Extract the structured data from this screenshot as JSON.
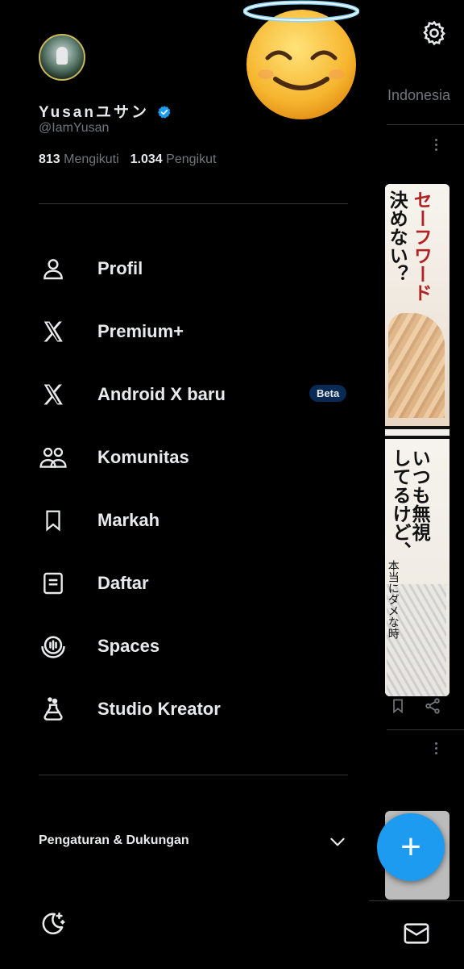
{
  "colors": {
    "background": "#000000",
    "text": "#e7e9ea",
    "muted": "#71767b",
    "accent": "#1d9bf0",
    "divider": "#2f3336",
    "beta_bg": "#082a55"
  },
  "profile": {
    "display_name": "Yusanユサン",
    "handle": "@IamYusan",
    "verified_icon": "verified-badge-icon",
    "following_count": "813",
    "following_label": "Mengikuti",
    "followers_count": "1.034",
    "followers_label": "Pengikut"
  },
  "menu": {
    "items": [
      {
        "label": "Profil",
        "icon": "person-icon"
      },
      {
        "label": "Premium+",
        "icon": "x-logo-icon"
      },
      {
        "label": "Android X baru",
        "icon": "x-logo-icon",
        "badge": "Beta"
      },
      {
        "label": "Komunitas",
        "icon": "people-icon"
      },
      {
        "label": "Markah",
        "icon": "bookmark-icon"
      },
      {
        "label": "Daftar",
        "icon": "list-icon"
      },
      {
        "label": "Spaces",
        "icon": "microphone-icon"
      },
      {
        "label": "Studio Kreator",
        "icon": "flask-icon"
      }
    ]
  },
  "settings": {
    "label": "Pengaturan & Dukungan",
    "icon": "chevron-down-icon"
  },
  "theme_toggle": {
    "icon": "moon-icon"
  },
  "background": {
    "tab_label": "Indonesia",
    "manga_text": [
      "セーフワード",
      "決めない？",
      "いつも無視",
      "してるけど、",
      "本当にダメな時"
    ],
    "compose_icon": "plus-icon",
    "settings_icon": "gear-icon",
    "messages_icon": "mail-icon"
  }
}
